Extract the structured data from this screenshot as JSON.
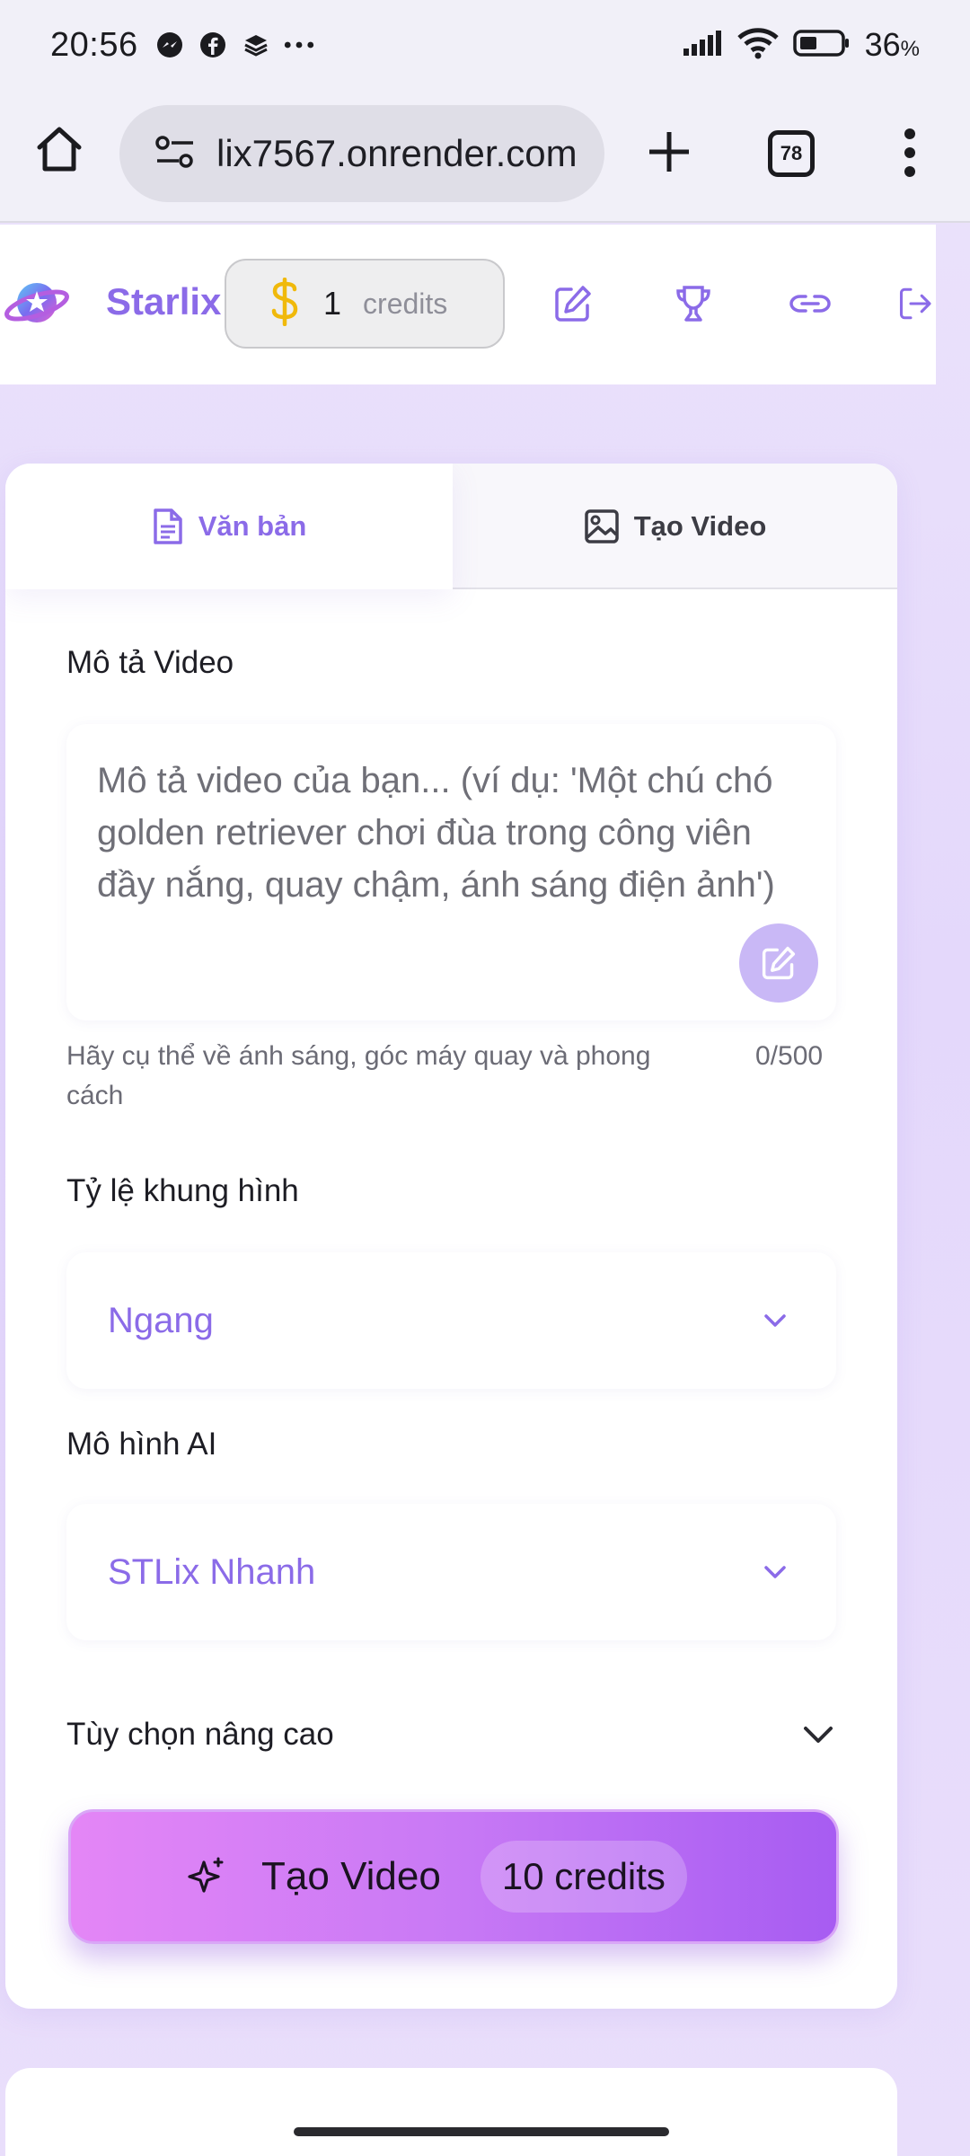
{
  "status_bar": {
    "time": "20:56",
    "battery": "36",
    "battery_unit": "%"
  },
  "browser": {
    "url": "lix7567.onrender.com",
    "tab_count": "78"
  },
  "header": {
    "brand": "Starlix",
    "credits_count": "1",
    "credits_label": "credits"
  },
  "tabs": [
    {
      "label": "Văn bản",
      "icon": "document-icon"
    },
    {
      "label": "Tạo Video",
      "icon": "image-icon"
    }
  ],
  "form": {
    "description_label": "Mô tả Video",
    "description_placeholder": "Mô tả video của bạn... (ví dụ: 'Một chú chó golden retriever chơi đùa trong công viên đầy nắng, quay chậm, ánh sáng điện ảnh')",
    "hint": "Hãy cụ thể về ánh sáng, góc máy quay và phong cách",
    "counter": "0/500",
    "aspect_label": "Tỷ lệ khung hình",
    "aspect_value": "Ngang",
    "model_label": "Mô hình AI",
    "model_value": "STLix Nhanh",
    "advanced_label": "Tùy chọn nâng cao"
  },
  "generate": {
    "label": "Tạo Video",
    "cost": "10 credits"
  },
  "colors": {
    "accent": "#8b6be8",
    "button_gradient_start": "#e486f6",
    "button_gradient_end": "#a75cf2"
  }
}
